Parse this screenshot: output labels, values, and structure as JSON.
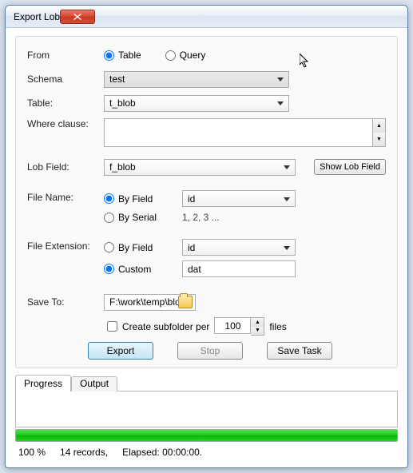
{
  "window": {
    "title": "Export Lob"
  },
  "form": {
    "from_label": "From",
    "from_table": "Table",
    "from_query": "Query",
    "schema_label": "Schema",
    "schema_value": "test",
    "table_label": "Table:",
    "table_value": "t_blob",
    "where_label": "Where clause:",
    "lob_label": "Lob Field:",
    "lob_value": "f_blob",
    "show_lob_btn": "Show Lob Field",
    "filename_label": "File Name:",
    "by_field": "By Field",
    "by_serial": "By Serial",
    "serial_hint": "1, 2, 3 ...",
    "filename_field_value": "id",
    "ext_label": "File Extension:",
    "ext_field_value": "id",
    "custom": "Custom",
    "custom_value": "dat",
    "save_label": "Save To:",
    "save_value": "F:\\work\\temp\\blobs",
    "subfolder_label": "Create subfolder per",
    "subfolder_count": "100",
    "subfolder_suffix": "files",
    "export_btn": "Export",
    "stop_btn": "Stop",
    "savetask_btn": "Save Task"
  },
  "tabs": {
    "progress": "Progress",
    "output": "Output"
  },
  "status": {
    "percent": "100 %",
    "records": "14 records,",
    "elapsed": "Elapsed: 00:00:00."
  }
}
